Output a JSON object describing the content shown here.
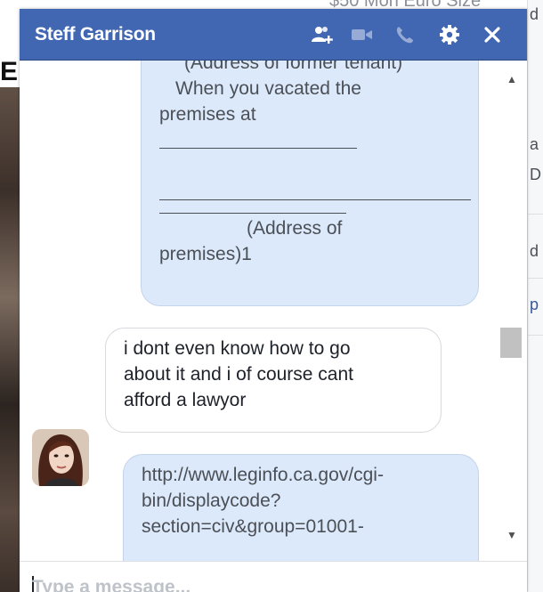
{
  "background": {
    "top_text": "$50 Mon Euro Size",
    "left_letter": "E",
    "right_fragments": [
      "d",
      "a",
      "D",
      "d",
      "p"
    ]
  },
  "chat": {
    "title": "Steff Garrison",
    "header_icons": [
      "add-friend-icon",
      "video-call-icon",
      "phone-icon",
      "gear-icon",
      "close-icon"
    ],
    "messages": [
      {
        "from": "me",
        "lines": [
          "(Address of former tenant)",
          "When you vacated the",
          "premises at",
          "",
          "",
          "",
          "(Address of",
          "premises)1"
        ]
      },
      {
        "from": "them",
        "lines": [
          "i dont even know how to go",
          "about it and i of course cant",
          "afford a lawyor"
        ]
      },
      {
        "from": "me",
        "lines": [
          "http://www.leginfo.ca.gov/cgi-",
          "bin/displaycode?",
          "section=civ&group=01001-"
        ]
      }
    ],
    "composer": {
      "placeholder": "Type a message...",
      "value": ""
    }
  },
  "colors": {
    "header": "#4267b2",
    "my_bubble": "#dce9fb",
    "their_bubble": "#ffffff",
    "text": "#4b4f56"
  }
}
